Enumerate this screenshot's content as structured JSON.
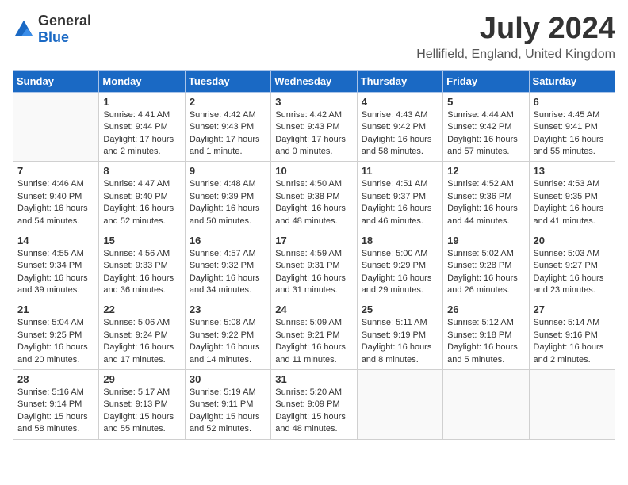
{
  "header": {
    "logo_general": "General",
    "logo_blue": "Blue",
    "title": "July 2024",
    "location": "Hellifield, England, United Kingdom"
  },
  "days_of_week": [
    "Sunday",
    "Monday",
    "Tuesday",
    "Wednesday",
    "Thursday",
    "Friday",
    "Saturday"
  ],
  "weeks": [
    [
      {
        "day": "",
        "info": ""
      },
      {
        "day": "1",
        "info": "Sunrise: 4:41 AM\nSunset: 9:44 PM\nDaylight: 17 hours\nand 2 minutes."
      },
      {
        "day": "2",
        "info": "Sunrise: 4:42 AM\nSunset: 9:43 PM\nDaylight: 17 hours\nand 1 minute."
      },
      {
        "day": "3",
        "info": "Sunrise: 4:42 AM\nSunset: 9:43 PM\nDaylight: 17 hours\nand 0 minutes."
      },
      {
        "day": "4",
        "info": "Sunrise: 4:43 AM\nSunset: 9:42 PM\nDaylight: 16 hours\nand 58 minutes."
      },
      {
        "day": "5",
        "info": "Sunrise: 4:44 AM\nSunset: 9:42 PM\nDaylight: 16 hours\nand 57 minutes."
      },
      {
        "day": "6",
        "info": "Sunrise: 4:45 AM\nSunset: 9:41 PM\nDaylight: 16 hours\nand 55 minutes."
      }
    ],
    [
      {
        "day": "7",
        "info": "Sunrise: 4:46 AM\nSunset: 9:40 PM\nDaylight: 16 hours\nand 54 minutes."
      },
      {
        "day": "8",
        "info": "Sunrise: 4:47 AM\nSunset: 9:40 PM\nDaylight: 16 hours\nand 52 minutes."
      },
      {
        "day": "9",
        "info": "Sunrise: 4:48 AM\nSunset: 9:39 PM\nDaylight: 16 hours\nand 50 minutes."
      },
      {
        "day": "10",
        "info": "Sunrise: 4:50 AM\nSunset: 9:38 PM\nDaylight: 16 hours\nand 48 minutes."
      },
      {
        "day": "11",
        "info": "Sunrise: 4:51 AM\nSunset: 9:37 PM\nDaylight: 16 hours\nand 46 minutes."
      },
      {
        "day": "12",
        "info": "Sunrise: 4:52 AM\nSunset: 9:36 PM\nDaylight: 16 hours\nand 44 minutes."
      },
      {
        "day": "13",
        "info": "Sunrise: 4:53 AM\nSunset: 9:35 PM\nDaylight: 16 hours\nand 41 minutes."
      }
    ],
    [
      {
        "day": "14",
        "info": "Sunrise: 4:55 AM\nSunset: 9:34 PM\nDaylight: 16 hours\nand 39 minutes."
      },
      {
        "day": "15",
        "info": "Sunrise: 4:56 AM\nSunset: 9:33 PM\nDaylight: 16 hours\nand 36 minutes."
      },
      {
        "day": "16",
        "info": "Sunrise: 4:57 AM\nSunset: 9:32 PM\nDaylight: 16 hours\nand 34 minutes."
      },
      {
        "day": "17",
        "info": "Sunrise: 4:59 AM\nSunset: 9:31 PM\nDaylight: 16 hours\nand 31 minutes."
      },
      {
        "day": "18",
        "info": "Sunrise: 5:00 AM\nSunset: 9:29 PM\nDaylight: 16 hours\nand 29 minutes."
      },
      {
        "day": "19",
        "info": "Sunrise: 5:02 AM\nSunset: 9:28 PM\nDaylight: 16 hours\nand 26 minutes."
      },
      {
        "day": "20",
        "info": "Sunrise: 5:03 AM\nSunset: 9:27 PM\nDaylight: 16 hours\nand 23 minutes."
      }
    ],
    [
      {
        "day": "21",
        "info": "Sunrise: 5:04 AM\nSunset: 9:25 PM\nDaylight: 16 hours\nand 20 minutes."
      },
      {
        "day": "22",
        "info": "Sunrise: 5:06 AM\nSunset: 9:24 PM\nDaylight: 16 hours\nand 17 minutes."
      },
      {
        "day": "23",
        "info": "Sunrise: 5:08 AM\nSunset: 9:22 PM\nDaylight: 16 hours\nand 14 minutes."
      },
      {
        "day": "24",
        "info": "Sunrise: 5:09 AM\nSunset: 9:21 PM\nDaylight: 16 hours\nand 11 minutes."
      },
      {
        "day": "25",
        "info": "Sunrise: 5:11 AM\nSunset: 9:19 PM\nDaylight: 16 hours\nand 8 minutes."
      },
      {
        "day": "26",
        "info": "Sunrise: 5:12 AM\nSunset: 9:18 PM\nDaylight: 16 hours\nand 5 minutes."
      },
      {
        "day": "27",
        "info": "Sunrise: 5:14 AM\nSunset: 9:16 PM\nDaylight: 16 hours\nand 2 minutes."
      }
    ],
    [
      {
        "day": "28",
        "info": "Sunrise: 5:16 AM\nSunset: 9:14 PM\nDaylight: 15 hours\nand 58 minutes."
      },
      {
        "day": "29",
        "info": "Sunrise: 5:17 AM\nSunset: 9:13 PM\nDaylight: 15 hours\nand 55 minutes."
      },
      {
        "day": "30",
        "info": "Sunrise: 5:19 AM\nSunset: 9:11 PM\nDaylight: 15 hours\nand 52 minutes."
      },
      {
        "day": "31",
        "info": "Sunrise: 5:20 AM\nSunset: 9:09 PM\nDaylight: 15 hours\nand 48 minutes."
      },
      {
        "day": "",
        "info": ""
      },
      {
        "day": "",
        "info": ""
      },
      {
        "day": "",
        "info": ""
      }
    ]
  ]
}
